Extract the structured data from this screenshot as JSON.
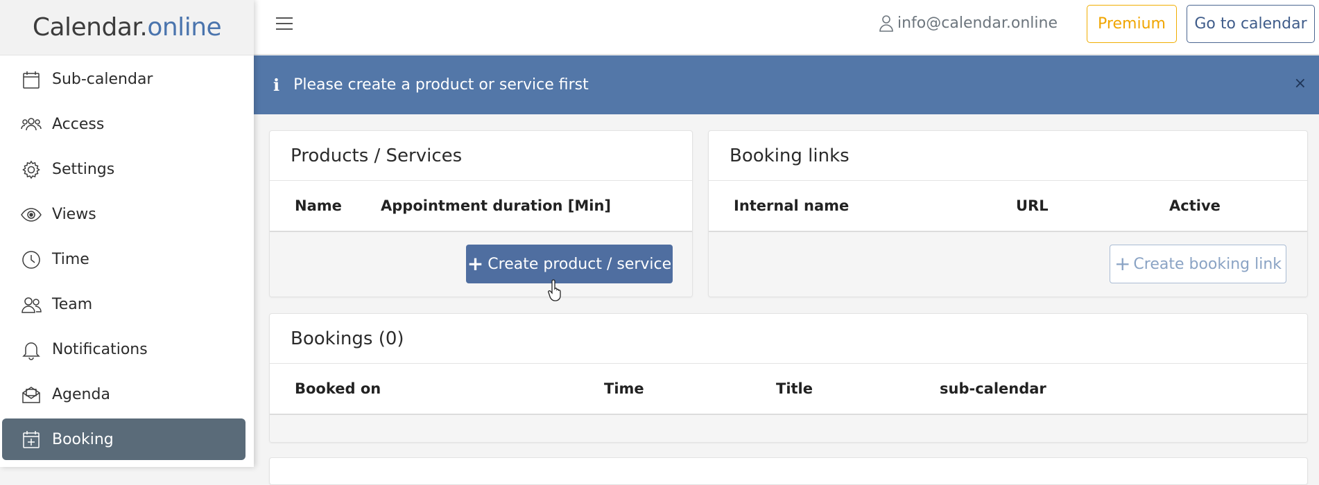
{
  "brand": {
    "main": "Calendar.",
    "tld": "online"
  },
  "sidebar": {
    "items": [
      {
        "label": "Sub-calendar",
        "icon": "calendar-icon"
      },
      {
        "label": "Access",
        "icon": "users-icon"
      },
      {
        "label": "Settings",
        "icon": "gear-icon"
      },
      {
        "label": "Views",
        "icon": "eye-icon"
      },
      {
        "label": "Time",
        "icon": "clock-icon"
      },
      {
        "label": "Team",
        "icon": "team-icon"
      },
      {
        "label": "Notifications",
        "icon": "bell-icon"
      },
      {
        "label": "Agenda",
        "icon": "mail-icon"
      },
      {
        "label": "Booking",
        "icon": "calendar-plus-icon",
        "active": true
      }
    ]
  },
  "header": {
    "user_email": "info@calendar.online",
    "premium_label": "Premium",
    "goto_label": "Go to calendar"
  },
  "alert": {
    "text": "Please create a product or service first",
    "close": "×"
  },
  "products": {
    "title": "Products / Services",
    "col_name": "Name",
    "col_duration": "Appointment duration [Min]",
    "button_plus": "+",
    "button_label": "Create product / service"
  },
  "booking_links": {
    "title": "Booking links",
    "col_internal": "Internal name",
    "col_url": "URL",
    "col_active": "Active",
    "button_plus": "+",
    "button_label": "Create booking link"
  },
  "bookings": {
    "title": "Bookings (0)",
    "col_booked_on": "Booked on",
    "col_time": "Time",
    "col_title": "Title",
    "col_subcal": "sub-calendar"
  },
  "colors": {
    "accent": "#5377a8",
    "premium": "#f0a500",
    "active_nav": "#5a6b79"
  }
}
